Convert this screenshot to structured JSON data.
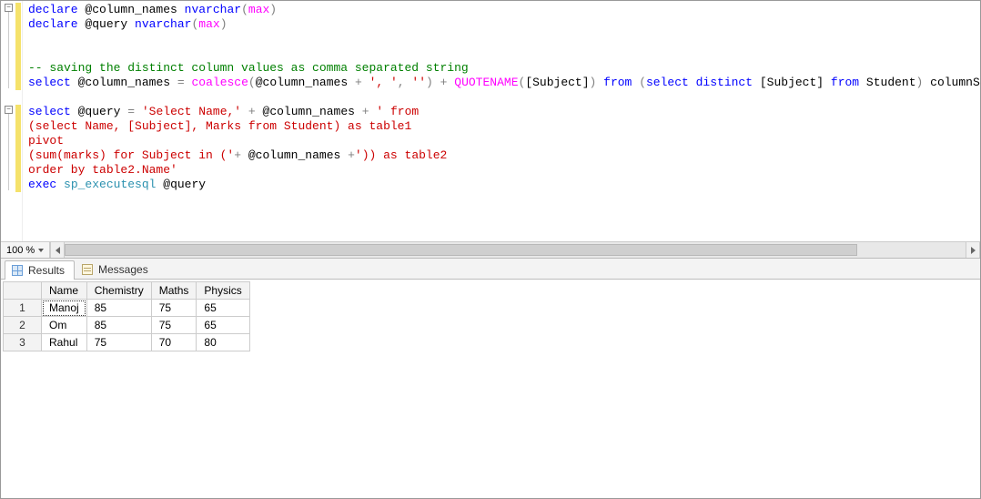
{
  "zoom": {
    "level": "100 %"
  },
  "code": {
    "lines": [
      {
        "tokens": [
          {
            "c": "kw",
            "t": "declare"
          },
          {
            "c": "sp",
            "t": " "
          },
          {
            "c": "var",
            "t": "@column_names"
          },
          {
            "c": "sp",
            "t": " "
          },
          {
            "c": "typ",
            "t": "nvarchar"
          },
          {
            "c": "op",
            "t": "("
          },
          {
            "c": "fn",
            "t": "max"
          },
          {
            "c": "op",
            "t": ")"
          }
        ]
      },
      {
        "tokens": [
          {
            "c": "kw",
            "t": "declare"
          },
          {
            "c": "sp",
            "t": " "
          },
          {
            "c": "var",
            "t": "@query"
          },
          {
            "c": "sp",
            "t": " "
          },
          {
            "c": "typ",
            "t": "nvarchar"
          },
          {
            "c": "op",
            "t": "("
          },
          {
            "c": "fn",
            "t": "max"
          },
          {
            "c": "op",
            "t": ")"
          }
        ]
      },
      {
        "blank": true
      },
      {
        "blank": true
      },
      {
        "tokens": [
          {
            "c": "cmt",
            "t": "-- saving the distinct column values as comma separated string"
          }
        ]
      },
      {
        "tokens": [
          {
            "c": "kw",
            "t": "select"
          },
          {
            "c": "sp",
            "t": " "
          },
          {
            "c": "var",
            "t": "@column_names"
          },
          {
            "c": "sp",
            "t": " "
          },
          {
            "c": "op",
            "t": "="
          },
          {
            "c": "sp",
            "t": " "
          },
          {
            "c": "fn",
            "t": "coalesce"
          },
          {
            "c": "op",
            "t": "("
          },
          {
            "c": "var",
            "t": "@column_names"
          },
          {
            "c": "sp",
            "t": " "
          },
          {
            "c": "op",
            "t": "+"
          },
          {
            "c": "sp",
            "t": " "
          },
          {
            "c": "str",
            "t": "', '"
          },
          {
            "c": "op",
            "t": ","
          },
          {
            "c": "sp",
            "t": " "
          },
          {
            "c": "str",
            "t": "''"
          },
          {
            "c": "op",
            "t": ")"
          },
          {
            "c": "sp",
            "t": " "
          },
          {
            "c": "op",
            "t": "+"
          },
          {
            "c": "sp",
            "t": " "
          },
          {
            "c": "fn",
            "t": "QUOTENAME"
          },
          {
            "c": "op",
            "t": "("
          },
          {
            "c": "var",
            "t": "[Subject]"
          },
          {
            "c": "op",
            "t": ")"
          },
          {
            "c": "sp",
            "t": " "
          },
          {
            "c": "kw",
            "t": "from"
          },
          {
            "c": "sp",
            "t": " "
          },
          {
            "c": "op",
            "t": "("
          },
          {
            "c": "kw",
            "t": "select"
          },
          {
            "c": "sp",
            "t": " "
          },
          {
            "c": "kw",
            "t": "distinct"
          },
          {
            "c": "sp",
            "t": " "
          },
          {
            "c": "var",
            "t": "[Subject]"
          },
          {
            "c": "sp",
            "t": " "
          },
          {
            "c": "kw",
            "t": "from"
          },
          {
            "c": "sp",
            "t": " "
          },
          {
            "c": "var",
            "t": "Student"
          },
          {
            "c": "op",
            "t": ")"
          },
          {
            "c": "sp",
            "t": " "
          },
          {
            "c": "var",
            "t": "columnString"
          }
        ]
      },
      {
        "blank": true
      },
      {
        "tokens": [
          {
            "c": "kw",
            "t": "select"
          },
          {
            "c": "sp",
            "t": " "
          },
          {
            "c": "var",
            "t": "@query"
          },
          {
            "c": "sp",
            "t": " "
          },
          {
            "c": "op",
            "t": "="
          },
          {
            "c": "sp",
            "t": " "
          },
          {
            "c": "str",
            "t": "'Select Name,'"
          },
          {
            "c": "sp",
            "t": " "
          },
          {
            "c": "op",
            "t": "+"
          },
          {
            "c": "sp",
            "t": " "
          },
          {
            "c": "var",
            "t": "@column_names"
          },
          {
            "c": "sp",
            "t": " "
          },
          {
            "c": "op",
            "t": "+"
          },
          {
            "c": "sp",
            "t": " "
          },
          {
            "c": "str",
            "t": "' from"
          }
        ]
      },
      {
        "tokens": [
          {
            "c": "str",
            "t": "(select Name, [Subject], Marks from Student) as table1"
          }
        ]
      },
      {
        "tokens": [
          {
            "c": "str",
            "t": "pivot"
          }
        ]
      },
      {
        "tokens": [
          {
            "c": "str",
            "t": "(sum(marks) for Subject in ('"
          },
          {
            "c": "op",
            "t": "+"
          },
          {
            "c": "sp",
            "t": " "
          },
          {
            "c": "var",
            "t": "@column_names"
          },
          {
            "c": "sp",
            "t": " "
          },
          {
            "c": "op",
            "t": "+"
          },
          {
            "c": "str",
            "t": "')) as table2"
          }
        ]
      },
      {
        "tokens": [
          {
            "c": "str",
            "t": "order by table2.Name'"
          }
        ]
      },
      {
        "tokens": [
          {
            "c": "kw",
            "t": "exec"
          },
          {
            "c": "sp",
            "t": " "
          },
          {
            "c": "nm",
            "t": "sp_executesql"
          },
          {
            "c": "sp",
            "t": " "
          },
          {
            "c": "var",
            "t": "@query"
          }
        ]
      }
    ],
    "indent": [
      0,
      0,
      0,
      0,
      0,
      0,
      0,
      0,
      0,
      0,
      0,
      0,
      0
    ]
  },
  "tabs": {
    "results": "Results",
    "messages": "Messages"
  },
  "grid": {
    "columns": [
      "Name",
      "Chemistry",
      "Maths",
      "Physics"
    ],
    "rows": [
      {
        "n": "1",
        "cells": [
          "Manoj",
          "85",
          "75",
          "65"
        ]
      },
      {
        "n": "2",
        "cells": [
          "Om",
          "85",
          "75",
          "65"
        ]
      },
      {
        "n": "3",
        "cells": [
          "Rahul",
          "75",
          "70",
          "80"
        ]
      }
    ]
  }
}
